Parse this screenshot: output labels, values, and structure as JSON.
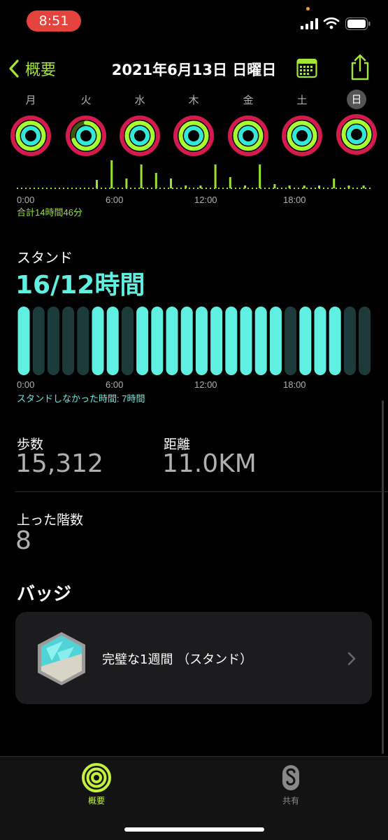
{
  "status_bar": {
    "time": "8:51"
  },
  "nav": {
    "back_label": "概要",
    "title": "2021年6月13日 日曜日"
  },
  "week": {
    "days": [
      {
        "label": "月",
        "selected": false
      },
      {
        "label": "火",
        "selected": false
      },
      {
        "label": "水",
        "selected": false
      },
      {
        "label": "木",
        "selected": false
      },
      {
        "label": "金",
        "selected": false
      },
      {
        "label": "土",
        "selected": false
      },
      {
        "label": "日",
        "selected": true
      }
    ],
    "ring_colors": {
      "move": "#fa1e5a",
      "exercise": "#a6ff2e",
      "stand": "#34e8d8"
    }
  },
  "exercise_chart": {
    "tick_labels": [
      "0:00",
      "6:00",
      "12:00",
      "18:00"
    ],
    "total_label": "合計14時間46分",
    "color": "#9be22a"
  },
  "stand": {
    "label": "スタンド",
    "value": "16/12時間",
    "tick_labels": [
      "0:00",
      "6:00",
      "12:00",
      "18:00"
    ],
    "footer": "スタンドしなかった時間: 7時間",
    "color": "#5ff0e2"
  },
  "stats": {
    "steps_label": "歩数",
    "steps_value": "15,312",
    "distance_label": "距離",
    "distance_value": "11.0KM",
    "floors_label": "上った階数",
    "floors_value": "8"
  },
  "badges": {
    "title": "バッジ",
    "items": [
      {
        "name": "完璧な1週間 （スタンド）"
      }
    ]
  },
  "tabbar": {
    "tabs": [
      {
        "label": "概要",
        "active": true
      },
      {
        "label": "共有",
        "active": false
      }
    ]
  },
  "chart_data": [
    {
      "type": "bar",
      "xlabel": "",
      "ylabel": "",
      "tick_labels": [
        "0:00",
        "6:00",
        "12:00",
        "18:00"
      ],
      "total": "合計14時間46分",
      "categories": [
        "0:00",
        "1:00",
        "2:00",
        "3:00",
        "4:00",
        "5:00",
        "6:00",
        "7:00",
        "8:00",
        "9:00",
        "10:00",
        "11:00",
        "12:00",
        "13:00",
        "14:00",
        "15:00",
        "16:00",
        "17:00",
        "18:00",
        "19:00",
        "20:00",
        "21:00",
        "22:00",
        "23:00"
      ],
      "values": [
        0,
        0,
        0,
        0,
        0,
        0.3,
        1.0,
        0.35,
        0.85,
        0.55,
        0.35,
        0.1,
        0.1,
        0.85,
        0.4,
        0.1,
        0.85,
        0.15,
        0.1,
        0.1,
        0.1,
        0.35,
        0.1,
        0.1
      ]
    },
    {
      "type": "bar",
      "xlabel": "",
      "ylabel": "",
      "tick_labels": [
        "0:00",
        "6:00",
        "12:00",
        "18:00"
      ],
      "footer": "スタンドしなかった時間: 7時間",
      "categories": [
        "0:00",
        "1:00",
        "2:00",
        "3:00",
        "4:00",
        "5:00",
        "6:00",
        "7:00",
        "8:00",
        "9:00",
        "10:00",
        "11:00",
        "12:00",
        "13:00",
        "14:00",
        "15:00",
        "16:00",
        "17:00",
        "18:00",
        "19:00",
        "20:00",
        "21:00",
        "22:00",
        "23:00"
      ],
      "values": [
        1,
        0,
        0,
        0,
        0,
        1,
        1,
        0,
        1,
        1,
        1,
        1,
        1,
        1,
        1,
        1,
        1,
        1,
        0,
        1,
        1,
        1,
        0,
        0
      ],
      "stood_count": 16,
      "goal": 12
    }
  ]
}
